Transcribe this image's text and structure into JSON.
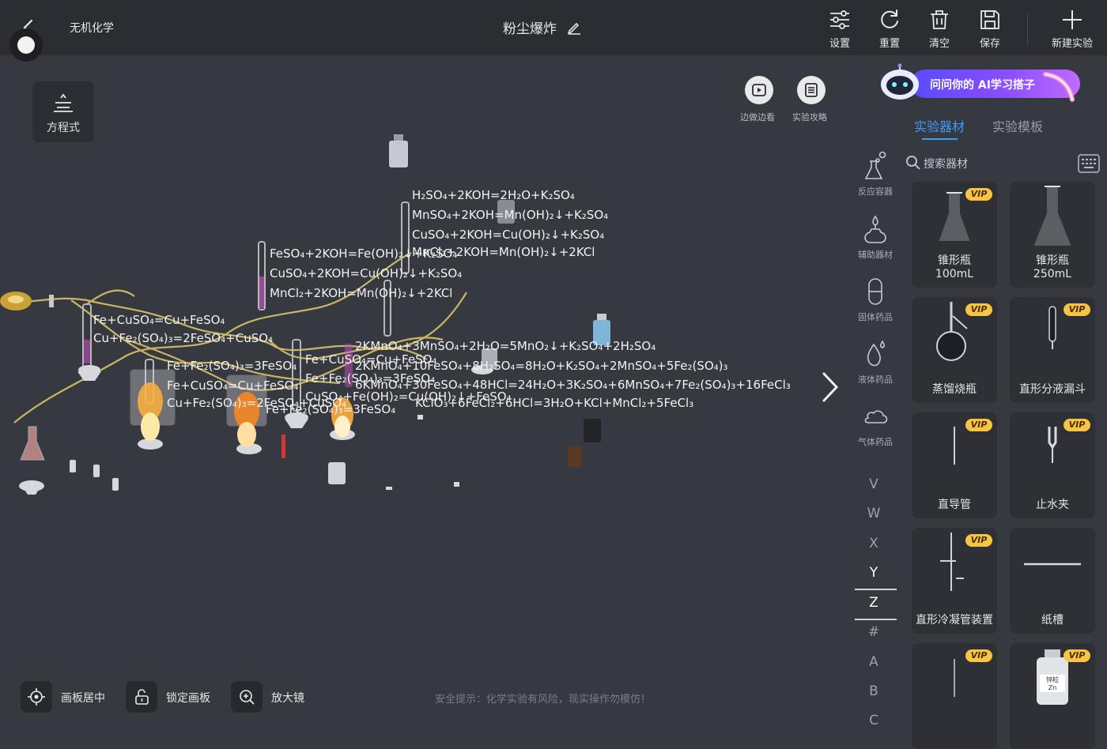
{
  "topbar": {
    "app_title": "无机化学",
    "experiment_title": "粉尘爆炸",
    "tools": [
      {
        "label": "设置",
        "icon": "settings-sliders-icon"
      },
      {
        "label": "重置",
        "icon": "reset-icon"
      },
      {
        "label": "清空",
        "icon": "trash-icon"
      },
      {
        "label": "保存",
        "icon": "save-icon"
      },
      {
        "label": "新建实验",
        "icon": "plus-icon"
      }
    ]
  },
  "left": {
    "equation_label": "方程式"
  },
  "canvas": {
    "equations": [
      "H₂SO₄+2KOH=2H₂O+K₂SO₄",
      "MnSO₄+2KOH=Mn(OH)₂↓+K₂SO₄",
      "CuSO₄+2KOH=Cu(OH)₂↓+K₂SO₄",
      "MnCl₂+2KOH=Mn(OH)₂↓+2KCl",
      "FeSO₄+2KOH=Fe(OH)₂↓+K₂SO₄",
      "CuSO₄+2KOH=Cu(OH)₂↓+K₂SO₄",
      "MnCl₂+2KOH=Mn(OH)₂↓+2KCl",
      "Fe+CuSO₄=Cu+FeSO₄",
      "Cu+Fe₂(SO₄)₃=2FeSO₄+CuSO₄",
      "Fe+Fe₂(SO₄)₃=3FeSO₄",
      "Fe+CuSO₄=Cu+FeSO₄",
      "Cu+Fe₂(SO₄)₃=2FeSO₄+CuSO₄",
      "Fe+CuSO₄=Cu+FeSO₄",
      "Fe+Fe₂(SO₄)₃=3FeSO₄",
      "CuSO₄+Fe(OH)₂=Cu(OH)₂↓+FeSO₄",
      "Fe+Fe₂(SO₄)₃=3FeSO₄",
      "2KMnO₄+3MnSO₄+2H₂O=5MnO₂↓+K₂SO₄+2H₂SO₄",
      "2KMnO₄+10FeSO₄+8H₂SO₄=8H₂O+K₂SO₄+2MnSO₄+5Fe₂(SO₄)₃",
      "6KMnO₄+30FeSO₄+48HCl=24H₂O+3K₂SO₄+6MnSO₄+7Fe₂(SO₄)₃+16FeCl₃",
      "KClO₃+6FeCl₂+6HCl=3H₂O+KCl+MnCl₂+5FeCl₃"
    ],
    "learn_while_doing": "边做边看",
    "experiment_guide": "实验攻略"
  },
  "bottom": {
    "center_board": "画板居中",
    "lock_board": "锁定画板",
    "magnifier": "放大镜",
    "safety_tip": "安全提示：化学实验有风险，现实操作勿模仿！"
  },
  "right": {
    "ai_banner": "问问你的 AI学习搭子",
    "tabs": [
      "实验器材",
      "实验模板"
    ],
    "active_tab": "实验器材",
    "search_placeholder": "搜索器材",
    "categories": [
      "反应容器",
      "辅助器材",
      "固体药品",
      "液体药品",
      "气体药品"
    ],
    "items": [
      {
        "name": "锥形瓶\n100mL",
        "vip": true
      },
      {
        "name": "锥形瓶\n250mL",
        "vip": false
      },
      {
        "name": "蒸馏烧瓶",
        "vip": true
      },
      {
        "name": "直形分液漏斗",
        "vip": true
      },
      {
        "name": "直导管",
        "vip": true
      },
      {
        "name": "止水夹",
        "vip": true
      },
      {
        "name": "直形冷凝管装置",
        "vip": true
      },
      {
        "name": "纸槽",
        "vip": false
      },
      {
        "name": "",
        "vip": true
      },
      {
        "name": "",
        "vip": true
      }
    ],
    "vip_label": "VIP",
    "bottle_label": "锌粒\nZn",
    "alphabet": [
      "V",
      "W",
      "X",
      "Y",
      "Z",
      "#",
      "A",
      "B",
      "C"
    ],
    "active_letter": "Z"
  }
}
